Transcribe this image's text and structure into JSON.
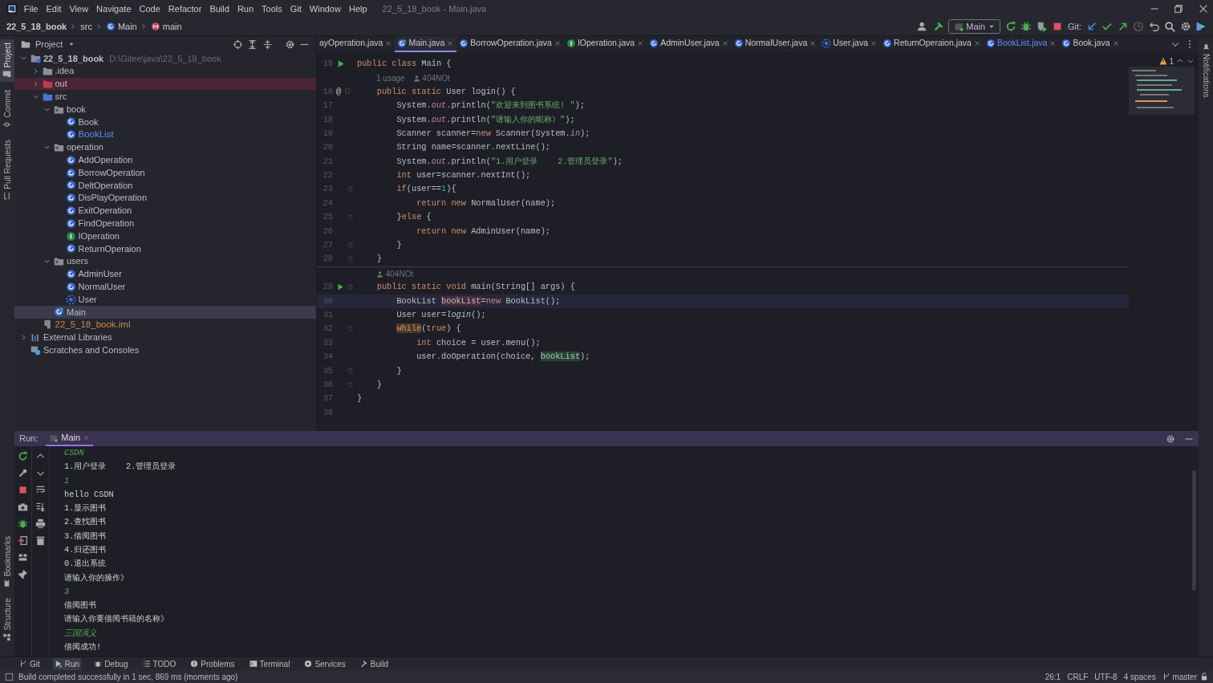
{
  "window": {
    "title": "22_5_18_book - Main.java",
    "menu": [
      "File",
      "Edit",
      "View",
      "Navigate",
      "Code",
      "Refactor",
      "Build",
      "Run",
      "Tools",
      "Git",
      "Window",
      "Help"
    ]
  },
  "breadcrumb": [
    {
      "text": "22_5_18_book",
      "kind": "project"
    },
    {
      "text": "src",
      "kind": "dir"
    },
    {
      "text": "Main",
      "kind": "class"
    },
    {
      "text": "main",
      "kind": "method"
    }
  ],
  "toolbar": {
    "run_config": "Main",
    "git_label": "Git:"
  },
  "left_strip": {
    "top": [
      {
        "label": "Project",
        "selected": true
      },
      {
        "label": "Commit",
        "selected": false
      },
      {
        "label": "Pull Requests",
        "selected": false
      }
    ],
    "bottom": [
      {
        "label": "Bookmarks",
        "selected": false
      },
      {
        "label": "Structure",
        "selected": false
      }
    ]
  },
  "right_strip": [
    {
      "label": "Notifications",
      "selected": false
    }
  ],
  "project_panel": {
    "title": "Project",
    "tree": [
      {
        "name": "22_5_18_book",
        "kind": "module",
        "path": "D:\\Gitee\\java\\22_5_18_book",
        "expanded": true,
        "selected": false,
        "children": [
          {
            "name": ".idea",
            "kind": "folder",
            "expanded": false,
            "selected": false
          },
          {
            "name": "out",
            "kind": "excluded",
            "expanded": false,
            "selected": false
          },
          {
            "name": "src",
            "kind": "source",
            "expanded": true,
            "selected": false,
            "children": [
              {
                "name": "book",
                "kind": "package",
                "expanded": true,
                "selected": false,
                "children": [
                  {
                    "name": "Book",
                    "kind": "class",
                    "selected": false
                  },
                  {
                    "name": "BookList",
                    "kind": "class",
                    "color": "#5f8ff0",
                    "selected": false
                  }
                ]
              },
              {
                "name": "operation",
                "kind": "package",
                "expanded": true,
                "selected": false,
                "children": [
                  {
                    "name": "AddOperation",
                    "kind": "class",
                    "selected": false
                  },
                  {
                    "name": "BorrowOperation",
                    "kind": "class",
                    "selected": false
                  },
                  {
                    "name": "DeltOperation",
                    "kind": "class",
                    "selected": false
                  },
                  {
                    "name": "DisPlayOperation",
                    "kind": "class",
                    "selected": false
                  },
                  {
                    "name": "ExitOperation",
                    "kind": "class",
                    "selected": false
                  },
                  {
                    "name": "FindOperation",
                    "kind": "class",
                    "selected": false
                  },
                  {
                    "name": "IOperation",
                    "kind": "interface",
                    "selected": false
                  },
                  {
                    "name": "ReturnOperaion",
                    "kind": "class",
                    "selected": false
                  }
                ]
              },
              {
                "name": "users",
                "kind": "package",
                "expanded": true,
                "selected": false,
                "children": [
                  {
                    "name": "AdminUser",
                    "kind": "class",
                    "selected": false
                  },
                  {
                    "name": "NormalUser",
                    "kind": "class",
                    "selected": false
                  },
                  {
                    "name": "User",
                    "kind": "abstract",
                    "selected": false
                  }
                ]
              },
              {
                "name": "Main",
                "kind": "main",
                "selected": true
              }
            ]
          },
          {
            "name": "22_5_18_book.iml",
            "kind": "iml",
            "color": "#d08b4a",
            "selected": false
          }
        ]
      },
      {
        "name": "External Libraries",
        "kind": "libraries",
        "expanded": false,
        "selected": false
      },
      {
        "name": "Scratches and Consoles",
        "kind": "scratches",
        "selected": false
      }
    ]
  },
  "tabs": [
    {
      "label": "ayOperation.java",
      "kind": "class",
      "selected": false
    },
    {
      "label": "Main.java",
      "kind": "main",
      "selected": true
    },
    {
      "label": "BorrowOperation.java",
      "kind": "class",
      "selected": false
    },
    {
      "label": "IOperation.java",
      "kind": "interface",
      "selected": false
    },
    {
      "label": "AdminUser.java",
      "kind": "class",
      "selected": false
    },
    {
      "label": "NormalUser.java",
      "kind": "class",
      "selected": false
    },
    {
      "label": "User.java",
      "kind": "abstract",
      "selected": false
    },
    {
      "label": "ReturnOperaion.java",
      "kind": "class",
      "selected": false
    },
    {
      "label": "BookList.java",
      "kind": "class",
      "color": "#5f8ff0",
      "selected": false
    },
    {
      "label": "Book.java",
      "kind": "class",
      "selected": false
    }
  ],
  "editor": {
    "warnings": "1",
    "lines": [
      {
        "kind": "code",
        "n": "15",
        "run": true,
        "fold": false,
        "current": false,
        "segs": [
          {
            "t": "public class ",
            "kind": "kw"
          },
          {
            "t": "Main {",
            "kind": "p"
          }
        ]
      },
      {
        "kind": "hint",
        "usages": "1 usage",
        "author": "404NOt",
        "separator": false
      },
      {
        "kind": "code",
        "n": "16",
        "mark": "@",
        "run": false,
        "fold": true,
        "current": false,
        "segs": [
          {
            "t": "    public static ",
            "kind": "kw"
          },
          {
            "t": "User login() {",
            "kind": "p"
          }
        ]
      },
      {
        "kind": "code",
        "n": "17",
        "run": false,
        "fold": false,
        "current": false,
        "segs": [
          {
            "t": "        System.",
            "kind": "p"
          },
          {
            "t": "out",
            "kind": "field"
          },
          {
            "t": ".println(",
            "kind": "p"
          },
          {
            "t": "\"欢迎来到图书系统! \"",
            "kind": "str"
          },
          {
            "t": ");",
            "kind": "p"
          }
        ]
      },
      {
        "kind": "code",
        "n": "18",
        "run": false,
        "fold": false,
        "current": false,
        "segs": [
          {
            "t": "        System.",
            "kind": "p"
          },
          {
            "t": "out",
            "kind": "field"
          },
          {
            "t": ".println(",
            "kind": "p"
          },
          {
            "t": "\"请输入你的昵称》\"",
            "kind": "str"
          },
          {
            "t": ");",
            "kind": "p"
          }
        ]
      },
      {
        "kind": "code",
        "n": "19",
        "run": false,
        "fold": false,
        "current": false,
        "segs": [
          {
            "t": "        Scanner scanner=",
            "kind": "p"
          },
          {
            "t": "new ",
            "kind": "kw"
          },
          {
            "t": "Scanner(System.",
            "kind": "p"
          },
          {
            "t": "in",
            "kind": "field"
          },
          {
            "t": ");",
            "kind": "p"
          }
        ]
      },
      {
        "kind": "code",
        "n": "20",
        "run": false,
        "fold": false,
        "current": false,
        "segs": [
          {
            "t": "        String name=scanner.nextLine();",
            "kind": "p"
          }
        ]
      },
      {
        "kind": "code",
        "n": "21",
        "run": false,
        "fold": false,
        "current": false,
        "segs": [
          {
            "t": "        System.",
            "kind": "p"
          },
          {
            "t": "out",
            "kind": "field"
          },
          {
            "t": ".println(",
            "kind": "p"
          },
          {
            "t": "\"1.用户登录    2.管理员登录\"",
            "kind": "str"
          },
          {
            "t": ");",
            "kind": "p"
          }
        ]
      },
      {
        "kind": "code",
        "n": "22",
        "run": false,
        "fold": false,
        "current": false,
        "segs": [
          {
            "t": "        int ",
            "kind": "kw"
          },
          {
            "t": "user=scanner.nextInt();",
            "kind": "p"
          }
        ]
      },
      {
        "kind": "code",
        "n": "23",
        "run": false,
        "fold": true,
        "current": false,
        "segs": [
          {
            "t": "        if",
            "kind": "kw"
          },
          {
            "t": "(user==",
            "kind": "p"
          },
          {
            "t": "1",
            "kind": "num"
          },
          {
            "t": "){",
            "kind": "p"
          }
        ]
      },
      {
        "kind": "code",
        "n": "24",
        "run": false,
        "fold": false,
        "current": false,
        "segs": [
          {
            "t": "            return new ",
            "kind": "kw"
          },
          {
            "t": "NormalUser(name);",
            "kind": "p"
          }
        ]
      },
      {
        "kind": "code",
        "n": "25",
        "run": false,
        "fold": true,
        "current": false,
        "segs": [
          {
            "t": "        }",
            "kind": "p"
          },
          {
            "t": "else ",
            "kind": "kw"
          },
          {
            "t": "{",
            "kind": "p"
          }
        ]
      },
      {
        "kind": "code",
        "n": "26",
        "run": false,
        "fold": false,
        "current": false,
        "segs": [
          {
            "t": "            return new ",
            "kind": "kw"
          },
          {
            "t": "AdminUser(name);",
            "kind": "p"
          }
        ]
      },
      {
        "kind": "code",
        "n": "27",
        "run": false,
        "fold": true,
        "current": false,
        "segs": [
          {
            "t": "        }",
            "kind": "p"
          }
        ]
      },
      {
        "kind": "code",
        "n": "28",
        "run": false,
        "fold": true,
        "current": false,
        "segs": [
          {
            "t": "    }",
            "kind": "p"
          }
        ]
      },
      {
        "kind": "hint",
        "author": "404NOt",
        "separator": true
      },
      {
        "kind": "code",
        "n": "29",
        "run": true,
        "fold": true,
        "current": false,
        "segs": [
          {
            "t": "    public static void ",
            "kind": "kw"
          },
          {
            "t": "main(String[] args) {",
            "kind": "p"
          }
        ]
      },
      {
        "kind": "code",
        "n": "30",
        "run": false,
        "fold": false,
        "current": true,
        "segs": [
          {
            "t": "        BookList ",
            "kind": "p"
          },
          {
            "t": "bookList",
            "kind": "write"
          },
          {
            "t": "=",
            "kind": "p"
          },
          {
            "t": "new ",
            "kind": "kw"
          },
          {
            "t": "BookList();",
            "kind": "p"
          }
        ]
      },
      {
        "kind": "code",
        "n": "31",
        "run": false,
        "fold": false,
        "current": false,
        "segs": [
          {
            "t": "        User user=",
            "kind": "p"
          },
          {
            "t": "login",
            "kind": "static"
          },
          {
            "t": "();",
            "kind": "p"
          }
        ]
      },
      {
        "kind": "code",
        "n": "32",
        "run": false,
        "fold": true,
        "current": false,
        "segs": [
          {
            "t": "        while",
            "kind": "exit"
          },
          {
            "t": "(",
            "kind": "p"
          },
          {
            "t": "true",
            "kind": "kw"
          },
          {
            "t": ") {",
            "kind": "p"
          }
        ]
      },
      {
        "kind": "code",
        "n": "33",
        "run": false,
        "fold": false,
        "current": false,
        "segs": [
          {
            "t": "            int ",
            "kind": "kw"
          },
          {
            "t": "choice = user.menu();",
            "kind": "p"
          }
        ]
      },
      {
        "kind": "code",
        "n": "34",
        "run": false,
        "fold": false,
        "current": false,
        "segs": [
          {
            "t": "            user.doOperation(choice, ",
            "kind": "p"
          },
          {
            "t": "bookList",
            "kind": "read"
          },
          {
            "t": ");",
            "kind": "p"
          }
        ]
      },
      {
        "kind": "code",
        "n": "35",
        "run": false,
        "fold": true,
        "current": false,
        "segs": [
          {
            "t": "        }",
            "kind": "p"
          }
        ]
      },
      {
        "kind": "code",
        "n": "36",
        "run": false,
        "fold": true,
        "current": false,
        "segs": [
          {
            "t": "    }",
            "kind": "p"
          }
        ]
      },
      {
        "kind": "code",
        "n": "37",
        "run": false,
        "fold": false,
        "current": false,
        "segs": [
          {
            "t": "}",
            "kind": "p"
          }
        ]
      },
      {
        "kind": "code",
        "n": "38",
        "run": false,
        "fold": false,
        "current": false
      }
    ]
  },
  "run_panel": {
    "label": "Run:",
    "tabs": [
      {
        "label": "Main",
        "selected": true
      }
    ],
    "output": [
      {
        "t": "CSDN",
        "kind": "input"
      },
      {
        "t": "1.用户登录    2.管理员登录",
        "kind": "out"
      },
      {
        "t": "1",
        "kind": "input"
      },
      {
        "t": "hello CSDN",
        "kind": "out"
      },
      {
        "t": "1.显示图书",
        "kind": "out"
      },
      {
        "t": "2.查找图书",
        "kind": "out"
      },
      {
        "t": "3.借阅图书",
        "kind": "out"
      },
      {
        "t": "4.归还图书",
        "kind": "out"
      },
      {
        "t": "0.退出系统",
        "kind": "out"
      },
      {
        "t": "请输入你的操作》",
        "kind": "out"
      },
      {
        "t": "3",
        "kind": "input"
      },
      {
        "t": "借阅图书",
        "kind": "out"
      },
      {
        "t": "请输入你要借阅书籍的名称》",
        "kind": "out"
      },
      {
        "t": "三国演义",
        "kind": "input"
      },
      {
        "t": "借阅成功!",
        "kind": "out"
      }
    ]
  },
  "tool_windows": [
    {
      "label": "Git",
      "kind": "git",
      "selected": false
    },
    {
      "label": "Run",
      "kind": "run",
      "selected": true
    },
    {
      "label": "Debug",
      "kind": "debug",
      "selected": false
    },
    {
      "label": "TODO",
      "kind": "todo",
      "selected": false
    },
    {
      "label": "Problems",
      "kind": "problems",
      "selected": false
    },
    {
      "label": "Terminal",
      "kind": "terminal",
      "selected": false
    },
    {
      "label": "Services",
      "kind": "services",
      "selected": false
    },
    {
      "label": "Build",
      "kind": "build",
      "selected": false
    }
  ],
  "status_bar": {
    "message": "Build completed successfully in 1 sec, 869 ms (moments ago)",
    "items": [
      "26:1",
      "CRLF",
      "UTF-8",
      "4 spaces"
    ],
    "branch": "master"
  }
}
